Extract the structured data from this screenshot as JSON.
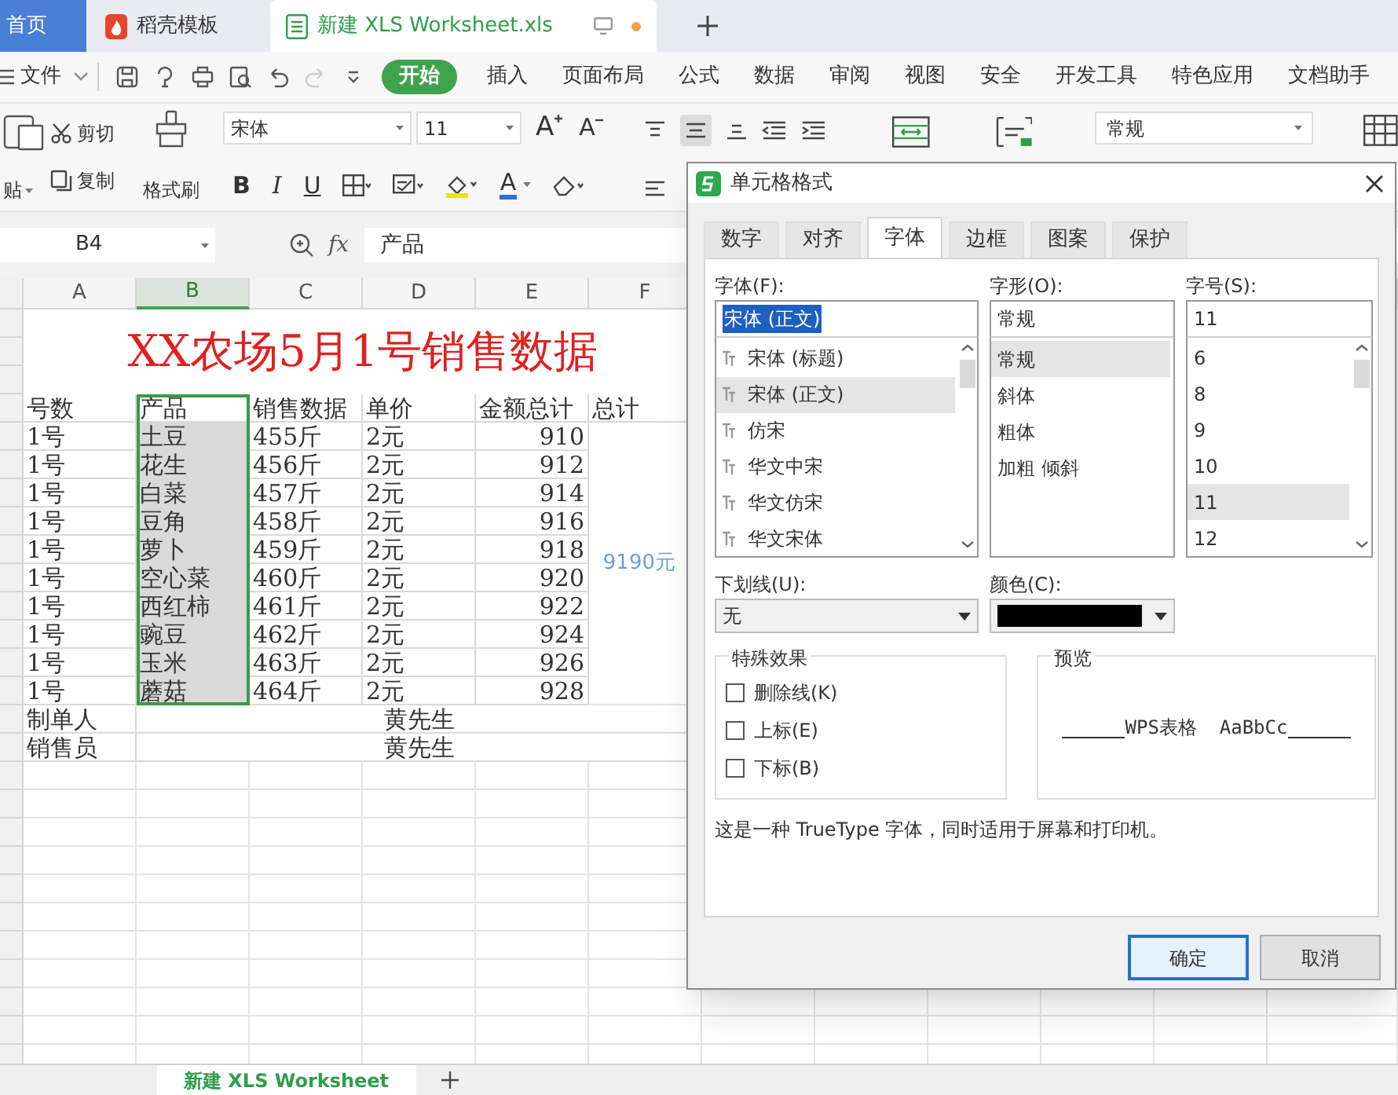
{
  "tabs": [
    {
      "label": "首页",
      "kind": "home",
      "selected": false
    },
    {
      "label": "稻壳模板",
      "kind": "docer",
      "selected": false
    },
    {
      "label": "新建 XLS Worksheet.xls",
      "kind": "file",
      "selected": true,
      "modified": true
    }
  ],
  "menu": {
    "file": "文件",
    "items": [
      {
        "label": "开始",
        "selected": true
      },
      {
        "label": "插入",
        "selected": false
      },
      {
        "label": "页面布局",
        "selected": false
      },
      {
        "label": "公式",
        "selected": false
      },
      {
        "label": "数据",
        "selected": false
      },
      {
        "label": "审阅",
        "selected": false
      },
      {
        "label": "视图",
        "selected": false
      },
      {
        "label": "安全",
        "selected": false
      },
      {
        "label": "开发工具",
        "selected": false
      },
      {
        "label": "特色应用",
        "selected": false
      },
      {
        "label": "文档助手",
        "selected": false
      }
    ]
  },
  "toolbar": {
    "paste": "贴",
    "cut": "剪切",
    "copy": "复制",
    "format_painter": "格式刷",
    "font": "宋体",
    "size": "11",
    "grow": "A",
    "shrink": "A",
    "bold": "B",
    "italic": "I",
    "underline": "U",
    "font_color": "A",
    "number_format": "常规"
  },
  "formula_bar": {
    "cell": "B4",
    "fx": "fx",
    "value": "产品"
  },
  "sheet": {
    "columns": [
      {
        "label": "A",
        "selected": false
      },
      {
        "label": "B",
        "selected": true
      },
      {
        "label": "C",
        "selected": false
      },
      {
        "label": "D",
        "selected": false
      },
      {
        "label": "E",
        "selected": false
      },
      {
        "label": "F",
        "selected": false
      }
    ],
    "title": "XX农场5月1号销售数据",
    "header": [
      "号数",
      "产品",
      "销售数据",
      "单价",
      "金额总计",
      "总计"
    ],
    "rows": [
      [
        "1号",
        "土豆",
        "455斤",
        "2元",
        "910"
      ],
      [
        "1号",
        "花生",
        "456斤",
        "2元",
        "912"
      ],
      [
        "1号",
        "白菜",
        "457斤",
        "2元",
        "914"
      ],
      [
        "1号",
        "豆角",
        "458斤",
        "2元",
        "916"
      ],
      [
        "1号",
        "萝卜",
        "459斤",
        "2元",
        "918"
      ],
      [
        "1号",
        "空心菜",
        "460斤",
        "2元",
        "920"
      ],
      [
        "1号",
        "西红柿",
        "461斤",
        "2元",
        "922"
      ],
      [
        "1号",
        "豌豆",
        "462斤",
        "2元",
        "924"
      ],
      [
        "1号",
        "玉米",
        "463斤",
        "2元",
        "926"
      ],
      [
        "1号",
        "蘑菇",
        "464斤",
        "2元",
        "928"
      ]
    ],
    "total": "9190元",
    "footer": [
      {
        "label": "制单人",
        "value": "黄先生"
      },
      {
        "label": "销售员",
        "value": "黄先生"
      }
    ]
  },
  "sheet_tabs": [
    {
      "label": "新建 XLS Worksheet",
      "selected": true
    }
  ],
  "dialog": {
    "title": "单元格格式",
    "tabs": [
      {
        "label": "数字",
        "selected": false
      },
      {
        "label": "对齐",
        "selected": false
      },
      {
        "label": "字体",
        "selected": true
      },
      {
        "label": "边框",
        "selected": false
      },
      {
        "label": "图案",
        "selected": false
      },
      {
        "label": "保护",
        "selected": false
      }
    ],
    "font": {
      "label": "字体(F):",
      "value": "宋体 (正文)",
      "options": [
        {
          "label": "宋体 (标题)",
          "selected": false
        },
        {
          "label": "宋体 (正文)",
          "selected": true
        },
        {
          "label": "仿宋",
          "selected": false
        },
        {
          "label": "华文中宋",
          "selected": false
        },
        {
          "label": "华文仿宋",
          "selected": false
        },
        {
          "label": "华文宋体",
          "selected": false
        }
      ]
    },
    "style": {
      "label": "字形(O):",
      "value": "常规",
      "options": [
        {
          "label": "常规",
          "selected": true
        },
        {
          "label": "斜体",
          "selected": false
        },
        {
          "label": "粗体",
          "selected": false
        },
        {
          "label": "加粗 倾斜",
          "selected": false
        }
      ]
    },
    "size": {
      "label": "字号(S):",
      "value": "11",
      "options": [
        {
          "label": "6",
          "selected": false
        },
        {
          "label": "8",
          "selected": false
        },
        {
          "label": "9",
          "selected": false
        },
        {
          "label": "10",
          "selected": false
        },
        {
          "label": "11",
          "selected": true
        },
        {
          "label": "12",
          "selected": false
        }
      ]
    },
    "underline": {
      "label": "下划线(U):",
      "value": "无"
    },
    "color": {
      "label": "颜色(C):",
      "color": "#000000"
    },
    "effects": {
      "title": "特殊效果",
      "items": [
        {
          "label": "删除线(K)",
          "checked": false
        },
        {
          "label": "上标(E)",
          "checked": false
        },
        {
          "label": "下标(B)",
          "checked": false
        }
      ]
    },
    "preview": {
      "title": "预览",
      "text": "WPS表格  AaBbCc"
    },
    "note": "这是一种 TrueType 字体，同时适用于屏幕和打印机。",
    "buttons": [
      {
        "label": "确定",
        "kind": "primary"
      },
      {
        "label": "取消",
        "kind": "secondary"
      }
    ]
  }
}
